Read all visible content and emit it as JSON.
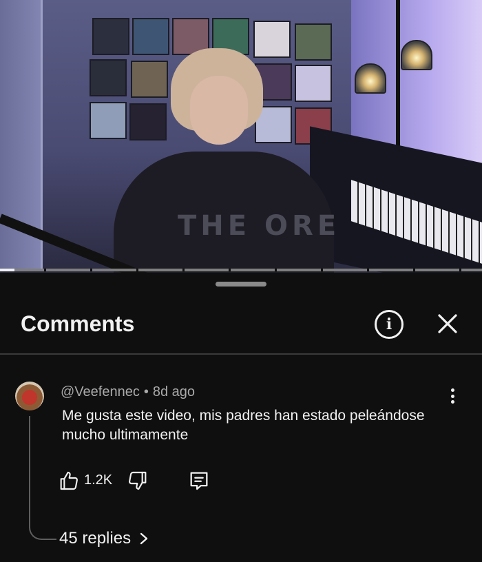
{
  "video": {
    "shirt_text": "THE  ORE",
    "progress_fraction": 0.03
  },
  "comments_panel": {
    "title": "Comments",
    "info_icon": "info-icon",
    "close_icon": "close-icon"
  },
  "comment": {
    "author": "@Veefennec",
    "separator": "•",
    "age": "8d ago",
    "text": "Me gusta este video, mis padres han estado peleándose mucho ultimamente",
    "likes": "1.2K",
    "replies_label": "45 replies"
  },
  "colors": {
    "background": "#0f0f0f",
    "text_primary": "#f1f1f1",
    "text_secondary": "#aaaaaa",
    "divider": "#3a3a3a"
  }
}
